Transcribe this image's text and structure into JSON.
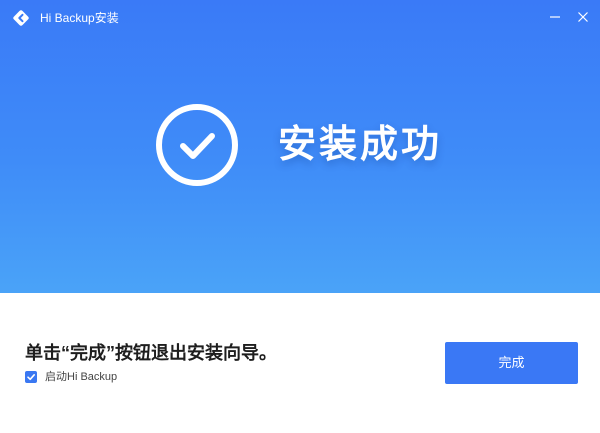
{
  "window": {
    "title": "Hi Backup安装",
    "app_icon": "hi-backup-logo-icon",
    "minimize_icon": "minimize-icon",
    "close_icon": "close-icon"
  },
  "hero": {
    "status_icon": "check-circle-icon",
    "status_text": "安装成功"
  },
  "footer": {
    "message": "单击“完成”按钮退出安装向导。",
    "launch_checkbox": {
      "label": "启动Hi Backup",
      "checked": true
    },
    "finish_button_label": "完成"
  },
  "colors": {
    "accent": "#3a78f5",
    "hero_top": "#3a7af7",
    "hero_bottom": "#4aa3f8",
    "text_dark": "#1e1e1e"
  }
}
